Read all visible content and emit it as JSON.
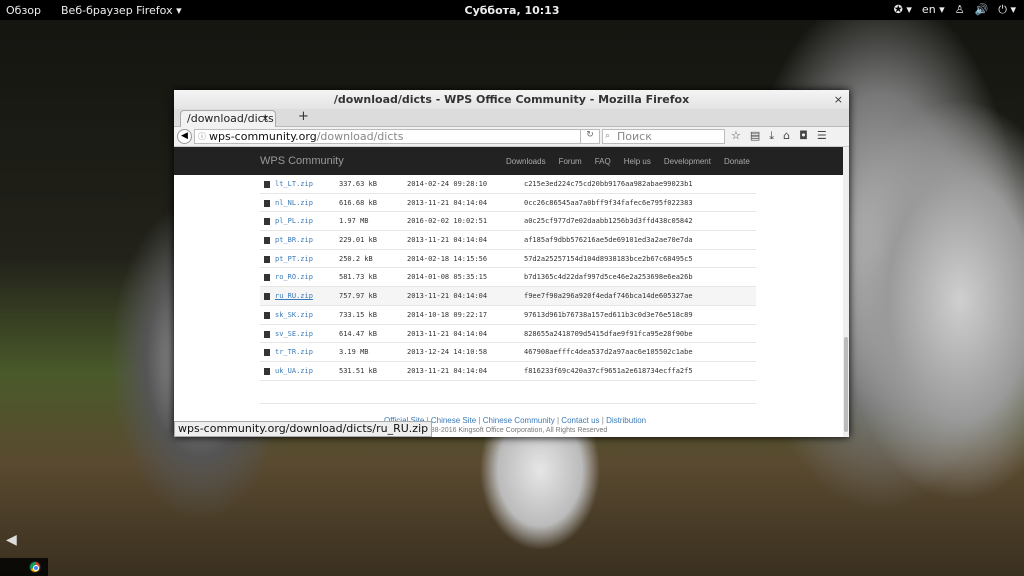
{
  "topbar": {
    "overview": "Обзор",
    "app": "Веб-браузер Firefox ▾",
    "clock": "Суббота, 10:13",
    "lang": "en ▾",
    "icons": [
      "accessibility-icon",
      "lock-icon",
      "volume-icon",
      "power-icon"
    ]
  },
  "window": {
    "title": "/download/dicts - WPS Office Community - Mozilla Firefox",
    "close": "×",
    "tab": {
      "label": "/download/dicts",
      "close": "×"
    },
    "new_tab": "+",
    "url": {
      "host": "wps-community.org",
      "path": "/download/dicts"
    },
    "search_placeholder": "Поиск"
  },
  "site": {
    "brand": "WPS Community",
    "menu": [
      "Downloads",
      "Forum",
      "FAQ",
      "Help us",
      "Development",
      "Donate"
    ],
    "files": [
      {
        "name": "lt_LT.zip",
        "size": "337.63 kB",
        "date": "2014-02-24 09:28:10",
        "hash": "c215e3ed224c75cd20bb9176aa982abae99023b1"
      },
      {
        "name": "nl_NL.zip",
        "size": "616.68 kB",
        "date": "2013-11-21 04:14:04",
        "hash": "0cc26c86545aa7a0bff9f34fafec6e795f022383"
      },
      {
        "name": "pl_PL.zip",
        "size": "1.97 MB",
        "date": "2016-02-02 10:02:51",
        "hash": "a0c25cf977d7e02daabb1256b3d3ffd438c05842"
      },
      {
        "name": "pt_BR.zip",
        "size": "229.01 kB",
        "date": "2013-11-21 04:14:04",
        "hash": "af185af9dbb576216ae5de69101ed3a2ae70e7da"
      },
      {
        "name": "pt_PT.zip",
        "size": "250.2 kB",
        "date": "2014-02-18 14:15:56",
        "hash": "57d2a25257154d104d8938183bce2b67c68495c5"
      },
      {
        "name": "ro_RO.zip",
        "size": "581.73 kB",
        "date": "2014-01-08 05:35:15",
        "hash": "b7d1365c4d22daf997d5ce46e2a253698e6ea26b"
      },
      {
        "name": "ru_RU.zip",
        "size": "757.97 kB",
        "date": "2013-11-21 04:14:04",
        "hash": "f9ee7f90a296a920f4edaf746bca14de605327ae"
      },
      {
        "name": "sk_SK.zip",
        "size": "733.15 kB",
        "date": "2014-10-18 09:22:17",
        "hash": "97613d961b76738a157ed611b3c0d3e76e518c89"
      },
      {
        "name": "sv_SE.zip",
        "size": "614.47 kB",
        "date": "2013-11-21 04:14:04",
        "hash": "828655a2418709d5415dfae9f91fca95e28f90be"
      },
      {
        "name": "tr_TR.zip",
        "size": "3.19 MB",
        "date": "2013-12-24 14:10:58",
        "hash": "467908aefffc4dea537d2a97aac6e105502c1abe"
      },
      {
        "name": "uk_UA.zip",
        "size": "531.51 kB",
        "date": "2013-11-21 04:14:04",
        "hash": "f816233f69c420a37cf9651a2e618734ecffa2f5"
      }
    ],
    "footer_links": [
      "Official Site",
      "Chinese Site",
      "Chinese Community",
      "Contact us",
      "Distribution"
    ],
    "copyright": "Copyright © 1988-2016 Kingsoft Office Corporation, All Rights Reserved"
  },
  "status_url": "wps-community.org/download/dicts/ru_RU.zip"
}
